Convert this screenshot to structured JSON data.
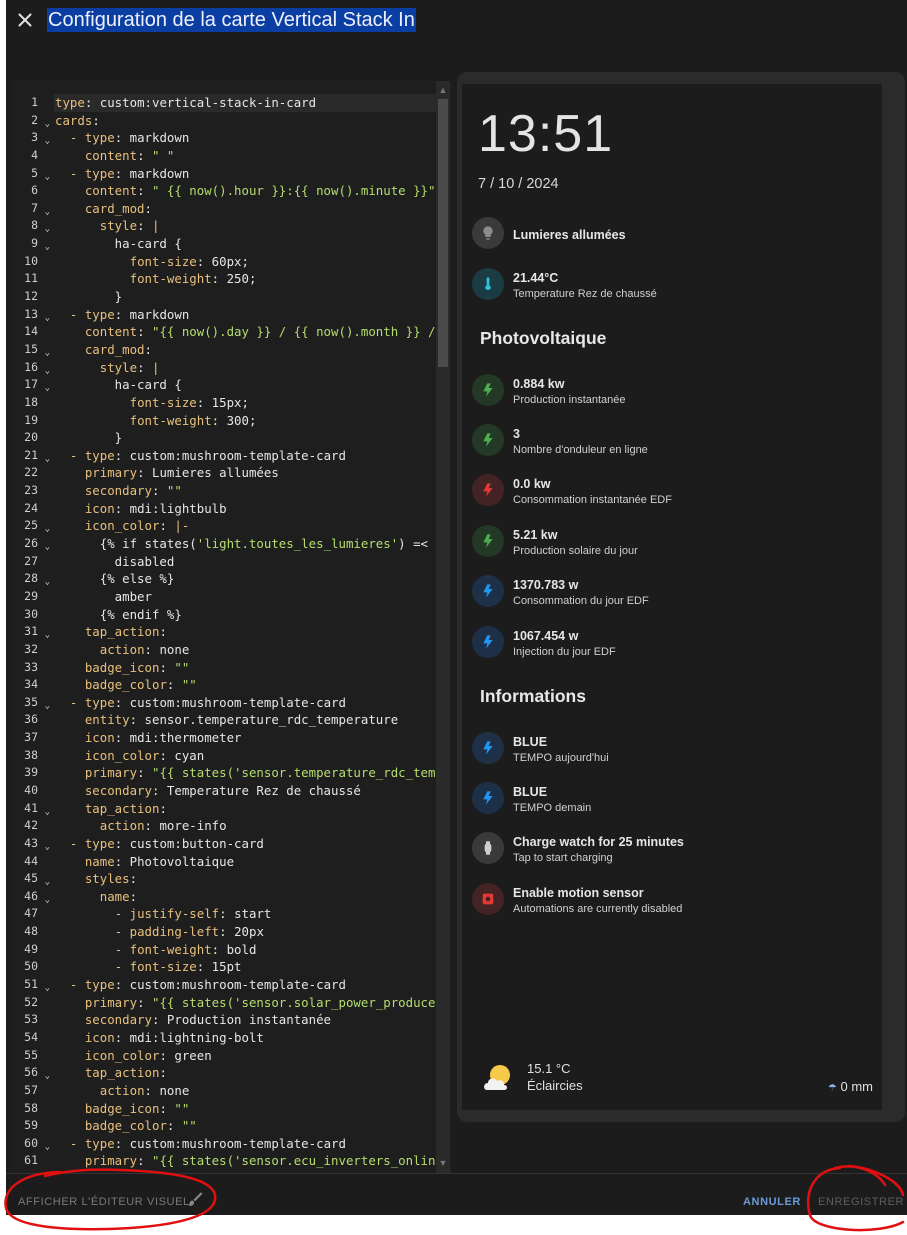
{
  "dialog": {
    "title": "Configuration de la carte Vertical Stack In",
    "close_icon": "close-icon"
  },
  "editor": {
    "language": "yaml",
    "lines": [
      [
        [
          "type",
          ": "
        ],
        [
          "custom:vertical-stack-in-card",
          ""
        ]
      ],
      [
        [
          "cards",
          ":"
        ]
      ],
      [
        [
          "  - type",
          ": "
        ],
        [
          "markdown",
          ""
        ]
      ],
      [
        [
          "    content",
          ": "
        ],
        [
          "\" \"",
          "s"
        ]
      ],
      [
        [
          "  - type",
          ": "
        ],
        [
          "markdown",
          ""
        ]
      ],
      [
        [
          "    content",
          ": "
        ],
        [
          "\" {{ now().hour }}:{{ now().minute }}\"",
          "s"
        ]
      ],
      [
        [
          "    card_mod",
          ":"
        ]
      ],
      [
        [
          "      style",
          ": "
        ],
        [
          "|",
          "k"
        ]
      ],
      [
        [
          "        ha-card {",
          ""
        ]
      ],
      [
        [
          "          font-size",
          ": "
        ],
        [
          "60px;",
          ""
        ]
      ],
      [
        [
          "          font-weight",
          ": "
        ],
        [
          "250;",
          ""
        ]
      ],
      [
        [
          "        }",
          ""
        ]
      ],
      [
        [
          "  - type",
          ": "
        ],
        [
          "markdown",
          ""
        ]
      ],
      [
        [
          "    content",
          ": "
        ],
        [
          "\"{{ now().day }} / {{ now().month }} / {{ n",
          "s"
        ]
      ],
      [
        [
          "    card_mod",
          ":"
        ]
      ],
      [
        [
          "      style",
          ": "
        ],
        [
          "|",
          "k"
        ]
      ],
      [
        [
          "        ha-card {",
          ""
        ]
      ],
      [
        [
          "          font-size",
          ": "
        ],
        [
          "15px;",
          ""
        ]
      ],
      [
        [
          "          font-weight",
          ": "
        ],
        [
          "300;",
          ""
        ]
      ],
      [
        [
          "        }",
          ""
        ]
      ],
      [
        [
          "  - type",
          ": "
        ],
        [
          "custom:mushroom-template-card",
          ""
        ]
      ],
      [
        [
          "    primary",
          ": "
        ],
        [
          "Lumieres allumées",
          ""
        ]
      ],
      [
        [
          "    secondary",
          ": "
        ],
        [
          "\"\"",
          "s"
        ]
      ],
      [
        [
          "    icon",
          ": "
        ],
        [
          "mdi:lightbulb",
          ""
        ]
      ],
      [
        [
          "    icon_color",
          ": "
        ],
        [
          "|-",
          "k"
        ]
      ],
      [
        [
          "      {% if states(",
          "w"
        ],
        [
          "'light.toutes_les_lumieres'",
          "s"
        ],
        [
          ") =< 'on' %}",
          "w"
        ]
      ],
      [
        [
          "        disabled",
          ""
        ]
      ],
      [
        [
          "      {% else %}",
          ""
        ]
      ],
      [
        [
          "        amber",
          ""
        ]
      ],
      [
        [
          "      {% endif %}",
          ""
        ]
      ],
      [
        [
          "    tap_action",
          ":"
        ]
      ],
      [
        [
          "      action",
          ": "
        ],
        [
          "none",
          ""
        ]
      ],
      [
        [
          "    badge_icon",
          ": "
        ],
        [
          "\"\"",
          "s"
        ]
      ],
      [
        [
          "    badge_color",
          ": "
        ],
        [
          "\"\"",
          "s"
        ]
      ],
      [
        [
          "  - type",
          ": "
        ],
        [
          "custom:mushroom-template-card",
          ""
        ]
      ],
      [
        [
          "    entity",
          ": "
        ],
        [
          "sensor.temperature_rdc_temperature",
          ""
        ]
      ],
      [
        [
          "    icon",
          ": "
        ],
        [
          "mdi:thermometer",
          ""
        ]
      ],
      [
        [
          "    icon_color",
          ": "
        ],
        [
          "cyan",
          ""
        ]
      ],
      [
        [
          "    primary",
          ": "
        ],
        [
          "\"{{ states('sensor.temperature_rdc_temperature') }}",
          "s"
        ]
      ],
      [
        [
          "    secondary",
          ": "
        ],
        [
          "Temperature Rez de chaussé",
          ""
        ]
      ],
      [
        [
          "    tap_action",
          ":"
        ]
      ],
      [
        [
          "      action",
          ": "
        ],
        [
          "more-info",
          ""
        ]
      ],
      [
        [
          "  - type",
          ": "
        ],
        [
          "custom:button-card",
          ""
        ]
      ],
      [
        [
          "    name",
          ": "
        ],
        [
          "Photovoltaique",
          ""
        ]
      ],
      [
        [
          "    styles",
          ":"
        ]
      ],
      [
        [
          "      name",
          ":"
        ]
      ],
      [
        [
          "        - justify-self",
          ": "
        ],
        [
          "start",
          ""
        ]
      ],
      [
        [
          "        - padding-left",
          ": "
        ],
        [
          "20px",
          ""
        ]
      ],
      [
        [
          "        - font-weight",
          ": "
        ],
        [
          "bold",
          ""
        ]
      ],
      [
        [
          "        - font-size",
          ": "
        ],
        [
          "15pt",
          ""
        ]
      ],
      [
        [
          "  - type",
          ": "
        ],
        [
          "custom:mushroom-template-card",
          ""
        ]
      ],
      [
        [
          "    primary",
          ": "
        ],
        [
          "\"{{ states('sensor.solar_power_produced') }}",
          "s"
        ]
      ],
      [
        [
          "    secondary",
          ": "
        ],
        [
          "Production instantanée",
          ""
        ]
      ],
      [
        [
          "    icon",
          ": "
        ],
        [
          "mdi:lightning-bolt",
          ""
        ]
      ],
      [
        [
          "    icon_color",
          ": "
        ],
        [
          "green",
          ""
        ]
      ],
      [
        [
          "    tap_action",
          ":"
        ]
      ],
      [
        [
          "      action",
          ": "
        ],
        [
          "none",
          ""
        ]
      ],
      [
        [
          "    badge_icon",
          ": "
        ],
        [
          "\"\"",
          "s"
        ]
      ],
      [
        [
          "    badge_color",
          ": "
        ],
        [
          "\"\"",
          "s"
        ]
      ],
      [
        [
          "  - type",
          ": "
        ],
        [
          "custom:mushroom-template-card",
          ""
        ]
      ],
      [
        [
          "    primary",
          ": "
        ],
        [
          "\"{{ states('sensor.ecu_inverters_online') }}",
          "s"
        ]
      ]
    ],
    "fold_lines": [
      2,
      3,
      5,
      7,
      8,
      9,
      13,
      15,
      16,
      17,
      21,
      25,
      26,
      28,
      31,
      35,
      41,
      43,
      45,
      46,
      51,
      56,
      60
    ]
  },
  "preview": {
    "time": "13:51",
    "date": "7 / 10 / 2024",
    "rows": [
      {
        "primary": "Lumieres allumées",
        "secondary": "",
        "icon": "lightbulb-icon",
        "color": "#8a8a8a",
        "bg": "#3a3a3a"
      },
      {
        "primary": "21.44°C",
        "secondary": "Temperature Rez de chaussé",
        "icon": "thermometer-icon",
        "color": "#2fc3d8",
        "bg": "#1b3c45"
      }
    ],
    "section_photovoltaique": "Photovoltaique",
    "pv_rows": [
      {
        "primary": "0.884 kw",
        "secondary": "Production instantanée",
        "icon": "lightning-bolt-icon",
        "color": "#4caf50",
        "bg": "#243826"
      },
      {
        "primary": "3",
        "secondary": "Nombre d'onduleur en ligne",
        "icon": "lightning-bolt-icon",
        "color": "#4caf50",
        "bg": "#243826"
      },
      {
        "primary": "0.0 kw",
        "secondary": "Consommation instantanée EDF",
        "icon": "lightning-bolt-icon",
        "color": "#e53935",
        "bg": "#432323"
      },
      {
        "primary": "5.21 kw",
        "secondary": "Production solaire du jour",
        "icon": "lightning-bolt-icon",
        "color": "#4caf50",
        "bg": "#243826"
      },
      {
        "primary": "1370.783 w",
        "secondary": "Consommation du jour EDF",
        "icon": "lightning-bolt-icon",
        "color": "#2196f3",
        "bg": "#1d3047"
      },
      {
        "primary": "1067.454 w",
        "secondary": "Injection du jour EDF",
        "icon": "lightning-bolt-icon",
        "color": "#2196f3",
        "bg": "#1d3047"
      }
    ],
    "section_informations": "Informations",
    "info_rows": [
      {
        "primary": "BLUE",
        "secondary": "TEMPO aujourd'hui",
        "icon": "lightning-bolt-icon",
        "color": "#2196f3",
        "bg": "#1d3047"
      },
      {
        "primary": "BLUE",
        "secondary": "TEMPO demain",
        "icon": "lightning-bolt-icon",
        "color": "#2196f3",
        "bg": "#1d3047"
      },
      {
        "primary": "Charge watch for 25 minutes",
        "secondary": "Tap to start charging",
        "icon": "watch-icon",
        "color": "#cfcfcf",
        "bg": "#3a3a3a"
      },
      {
        "primary": "Enable motion sensor",
        "secondary": "Automations are currently disabled",
        "icon": "motion-sensor-icon",
        "color": "#e53935",
        "bg": "#432323"
      }
    ],
    "weather": {
      "temperature": "15.1 °C",
      "condition": "Éclaircies",
      "precipitation": "0 mm",
      "icon": "partly-cloudy-icon"
    }
  },
  "footer": {
    "show_visual_editor": "AFFICHER L'ÉDITEUR VISUEL",
    "cancel": "ANNULER",
    "save": "ENREGISTRER"
  },
  "colors": {
    "background": "#1c1c1c",
    "title_highlight": "#0b3ea3",
    "yaml_key": "#e8c07d",
    "yaml_string": "#b4de6e",
    "annotation_red": "#e01010",
    "accent_blue": "#6b9bd6"
  }
}
